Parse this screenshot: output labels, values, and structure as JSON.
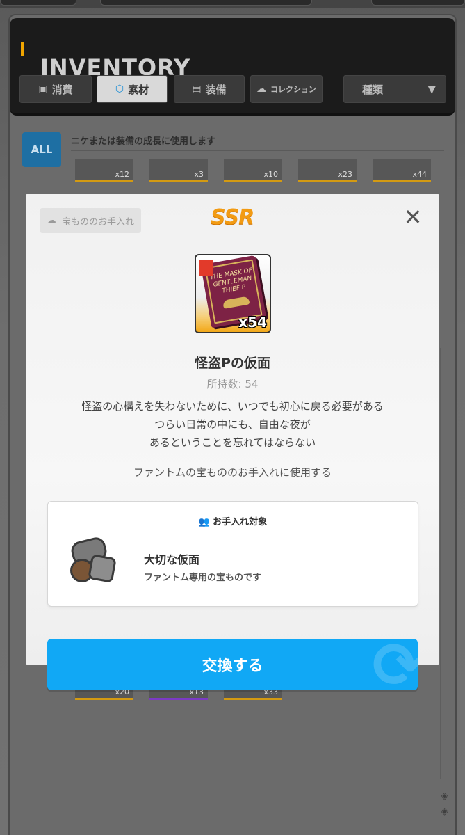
{
  "header": {
    "title": "INVENTORY",
    "tabs": [
      {
        "label": "消費",
        "icon": "consumable-icon"
      },
      {
        "label": "素材",
        "icon": "material-icon",
        "active": true
      },
      {
        "label": "装備",
        "icon": "equipment-icon"
      },
      {
        "label": "コレクション",
        "icon": "hat-icon"
      }
    ],
    "sort_label": "種類"
  },
  "filter": {
    "all_label": "ALL",
    "hint": "ニケまたは装備の成長に使用します"
  },
  "grid_top": [
    "x12",
    "x3",
    "x10",
    "x23",
    "x44"
  ],
  "grid_bottom": [
    "x20",
    "x13",
    "x33"
  ],
  "modal": {
    "tag_label": "宝もののお手入れ",
    "rarity": "SSR",
    "item_quantity": "x54",
    "book_text": "THE MASK OF GENTLEMAN THIEF P",
    "item_name": "怪盗Pの仮面",
    "owned": "所持数: 54",
    "description_lines": [
      "怪盗の心構えを失わないために、いつでも初心に戻る必要がある",
      "つらい日常の中にも、自由な夜が",
      "あるということを忘れてはならない"
    ],
    "usage": "ファントムの宝もののお手入れに使用する",
    "target": {
      "title": "お手入れ対象",
      "name": "大切な仮面",
      "subtitle": "ファントム専用の宝ものです"
    },
    "exchange_label": "交換する"
  },
  "colors": {
    "accent": "#f29b13",
    "button": "#11a8f5",
    "rarity_orange": "#d39a12"
  }
}
